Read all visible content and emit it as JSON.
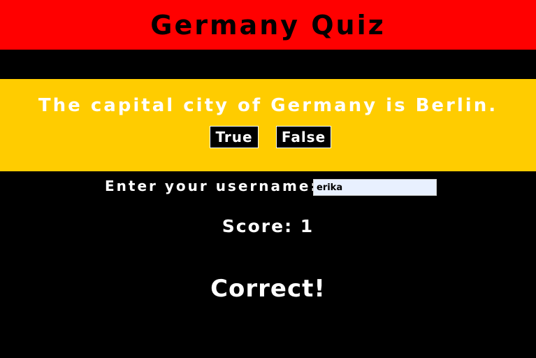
{
  "header": {
    "title": "Germany Quiz"
  },
  "question": {
    "text": "The capital city of Germany is Berlin.",
    "true_label": "True",
    "false_label": "False"
  },
  "username": {
    "label": "Enter your username:",
    "value": "erika"
  },
  "score": {
    "label": "Score:",
    "value": "1"
  },
  "feedback": {
    "text": "Correct!"
  },
  "colors": {
    "header_bg": "#ff0000",
    "panel_bg": "#ffcc00",
    "page_bg": "#000000",
    "text": "#ffffff",
    "input_bg": "#e8f0fe"
  }
}
